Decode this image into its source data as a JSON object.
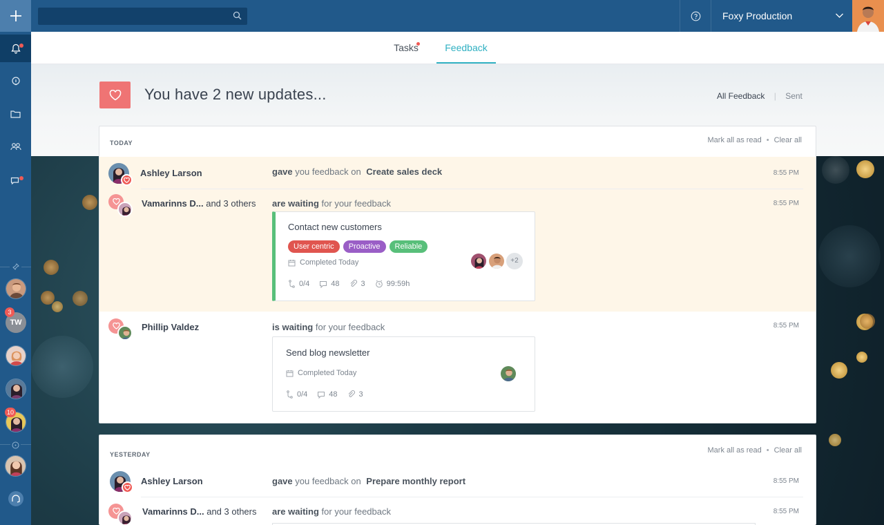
{
  "colors": {
    "rail": "#21598a",
    "accent": "#2fb0c2",
    "danger": "#ef5a55",
    "highlight_row": "#fef6e8"
  },
  "topbar": {
    "search_placeholder": "",
    "workspace": "Foxy Production"
  },
  "tabs": [
    {
      "label": "Tasks",
      "has_dot": true
    },
    {
      "label": "Feedback",
      "active": true
    }
  ],
  "header": {
    "title": "You have 2 new updates...",
    "filter_all": "All Feedback",
    "filter_sep": "|",
    "filter_sent": "Sent"
  },
  "rail": {
    "badge_tw": "3",
    "initials_tw": "TW",
    "badge_last": "10"
  },
  "today": {
    "label": "TODAY",
    "mark_all": "Mark all as read",
    "bullet": "•",
    "clear_all": "Clear all",
    "rows": [
      {
        "name": "Ashley Larson",
        "verb": "gave",
        "rest": "you feedback on",
        "target": "Create sales deck",
        "time": "8:55 PM"
      },
      {
        "name": "Vamarinns D...",
        "others": "and 3 others",
        "verb": "are waiting",
        "rest": "for your feedback",
        "time": "8:55 PM",
        "task": {
          "title": "Contact new customers",
          "tags": [
            "User centric",
            "Proactive",
            "Reliable"
          ],
          "status": "Completed Today",
          "subtasks": "0/4",
          "comments": "48",
          "attachments": "3",
          "timer": "99:59h",
          "more": "+2"
        }
      },
      {
        "name": "Phillip Valdez",
        "verb": "is waiting",
        "rest": "for your feedback",
        "time": "8:55 PM",
        "task": {
          "title": "Send blog newsletter",
          "status": "Completed Today",
          "subtasks": "0/4",
          "comments": "48",
          "attachments": "3"
        }
      }
    ]
  },
  "yesterday": {
    "label": "YESTERDAY",
    "mark_all": "Mark all as read",
    "bullet": "•",
    "clear_all": "Clear all",
    "rows": [
      {
        "name": "Ashley Larson",
        "verb": "gave",
        "rest": "you feedback on",
        "target": "Prepare monthly report",
        "time": "8:55 PM"
      },
      {
        "name": "Vamarinns D...",
        "others": "and 3 others",
        "verb": "are waiting",
        "rest": "for your feedback",
        "time": "8:55 PM"
      }
    ]
  },
  "tag_colors": [
    "#e0554f",
    "#9a5ec6",
    "#58bf7a"
  ],
  "icons": [
    "plus-icon",
    "bell-icon",
    "lightbulb-icon",
    "folder-icon",
    "people-icon",
    "chat-icon",
    "pin-icon",
    "compass-icon",
    "headset-icon",
    "search-icon",
    "help-icon",
    "chevron-down-icon",
    "heart-icon",
    "calendar-icon",
    "subtask-icon",
    "comment-icon",
    "attachment-icon",
    "timer-icon"
  ]
}
